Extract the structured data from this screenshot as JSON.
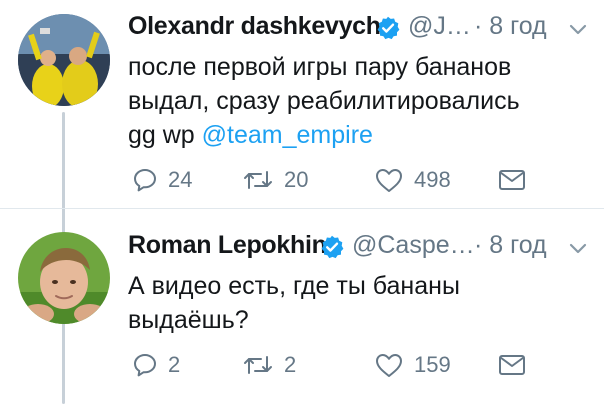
{
  "tweets": [
    {
      "name": "Olexandr dashkevych",
      "handle": "@J…",
      "time": "· 8 год",
      "text_line1": "после первой игры пару бананов",
      "text_line2": "выдал, сразу реабилитировались",
      "text_line3_prefix": "gg wp ",
      "mention": "@team_empire",
      "replies": "24",
      "retweets": "20",
      "likes": "498",
      "avatar_icon": "team-photo-avatar"
    },
    {
      "name": "Roman Lepokhin",
      "handle": "@Caspe…",
      "time": "· 8 год",
      "text_line1": "А видео есть, где ты бананы",
      "text_line2": "выдаёшь?",
      "replies": "2",
      "retweets": "2",
      "likes": "159",
      "avatar_icon": "person-photo-avatar"
    }
  ],
  "colors": {
    "verified": "#1da1f2",
    "mention": "#1da1f2",
    "muted": "#657786",
    "thread_line": "#c7d0d8"
  }
}
